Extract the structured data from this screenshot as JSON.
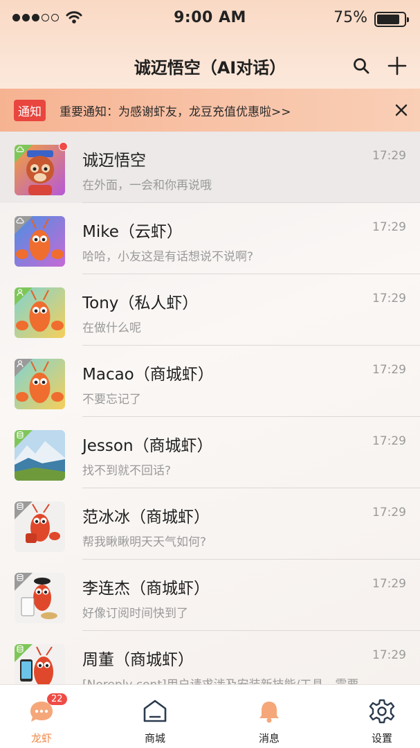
{
  "status_bar": {
    "time": "9:00 AM",
    "battery": "75%"
  },
  "nav": {
    "title": "诚迈悟空（AI对话）"
  },
  "notice": {
    "tag": "通知",
    "text": "重要通知：为感谢虾友，龙豆充值优惠啦>>"
  },
  "chats": [
    {
      "name": "诚迈悟空",
      "message": "在外面，一会和你再说哦",
      "time": "17:29",
      "avatar": "monkey-king",
      "corner": "cloud",
      "corner_color": "#7fc65a",
      "unread_dot": true
    },
    {
      "name": "Mike（云虾）",
      "message": "哈哈，小友这是有话想说不说啊?",
      "time": "17:29",
      "avatar": "lobster-blue",
      "corner": "cloud",
      "corner_color": "#9a9a9a",
      "unread_dot": false
    },
    {
      "name": "Tony（私人虾）",
      "message": "在做什么呢",
      "time": "17:29",
      "avatar": "lobster-yellow",
      "corner": "person",
      "corner_color": "#7fc65a",
      "unread_dot": false
    },
    {
      "name": "Macao（商城虾）",
      "message": "不要忘记了",
      "time": "17:29",
      "avatar": "lobster-yellow",
      "corner": "person",
      "corner_color": "#9a9a9a",
      "unread_dot": false
    },
    {
      "name": "Jesson（商城虾）",
      "message": "找不到就不回话?",
      "time": "17:29",
      "avatar": "landscape",
      "corner": "database",
      "corner_color": "#7fc65a",
      "unread_dot": false
    },
    {
      "name": "范冰冰（商城虾）",
      "message": "帮我瞅瞅明天天气如何?",
      "time": "17:29",
      "avatar": "lobster-white",
      "corner": "database",
      "corner_color": "#9a9a9a",
      "unread_dot": false
    },
    {
      "name": "李连杰（商城虾）",
      "message": "好像订阅时间快到了",
      "time": "17:29",
      "avatar": "lobster-painter",
      "corner": "database",
      "corner_color": "#9a9a9a",
      "unread_dot": false
    },
    {
      "name": "周董（商城虾）",
      "message": "[Noreply cont]用户请求涉及安装新技能/工具，需要",
      "time": "17:29",
      "avatar": "lobster-phone",
      "corner": "database",
      "corner_color": "#7fc65a",
      "unread_dot": false
    }
  ],
  "tabs": [
    {
      "label": "龙虾",
      "icon": "chat-bubble-icon",
      "active": true,
      "badge": "22"
    },
    {
      "label": "商城",
      "icon": "store-icon",
      "active": false
    },
    {
      "label": "消息",
      "icon": "bell-icon",
      "active": false
    },
    {
      "label": "设置",
      "icon": "gear-icon",
      "active": false
    }
  ]
}
